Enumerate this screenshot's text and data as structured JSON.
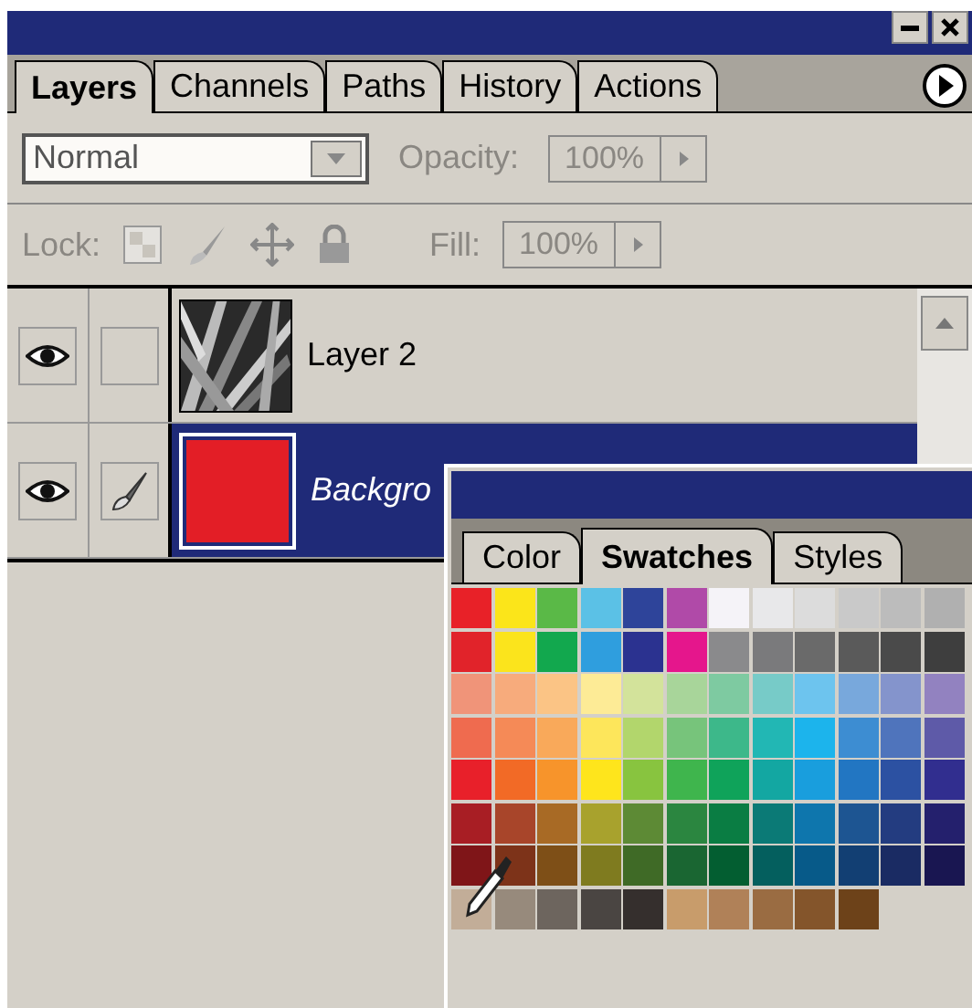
{
  "tabs": [
    {
      "label": "Layers",
      "selected": true
    },
    {
      "label": "Channels",
      "selected": false
    },
    {
      "label": "Paths",
      "selected": false
    },
    {
      "label": "History",
      "selected": false
    },
    {
      "label": "Actions",
      "selected": false
    }
  ],
  "blend_mode": {
    "value": "Normal"
  },
  "opacity": {
    "label": "Opacity:",
    "value": "100%",
    "disabled": true
  },
  "lock": {
    "label": "Lock:",
    "disabled": true
  },
  "fill": {
    "label": "Fill:",
    "value": "100%",
    "disabled": true
  },
  "layers": [
    {
      "name": "Layer 2",
      "selected": false,
      "visible": true,
      "brush": false,
      "kind": "picture"
    },
    {
      "name": "Backgro",
      "selected": true,
      "visible": true,
      "brush": true,
      "kind": "color",
      "color": "#e31e26"
    }
  ],
  "swatches_panel": {
    "tabs": [
      {
        "label": "Color",
        "selected": false
      },
      {
        "label": "Swatches",
        "selected": true
      },
      {
        "label": "Styles",
        "selected": false
      }
    ],
    "rows": [
      {
        "swatches": [
          {
            "color": "#e82128"
          },
          {
            "color": "#fbe51a"
          },
          {
            "color": "#5ab947"
          },
          {
            "color": "#5bc1e6"
          },
          {
            "color": "#2e449a"
          },
          {
            "color": "#b04aa8"
          },
          {
            "color": "#f5f3f8"
          },
          {
            "color": "#e8e8ea"
          },
          {
            "color": "#dcdcdc"
          },
          {
            "color": "#c9c9c9"
          },
          {
            "color": "#bcbcbc"
          },
          {
            "color": "#b0b0b0"
          }
        ]
      },
      {
        "swatches": [
          {
            "color": "#e1232a"
          },
          {
            "color": "#fbe41c"
          },
          {
            "color": "#12a84e"
          },
          {
            "color": "#2f9ede"
          },
          {
            "color": "#2b3290"
          },
          {
            "color": "#e5168c"
          },
          {
            "color": "#8a8a8c"
          },
          {
            "color": "#7a7a7c"
          },
          {
            "color": "#6a6a6a"
          },
          {
            "color": "#5a5a5a"
          },
          {
            "color": "#4a4a4a"
          },
          {
            "color": "#3e3e3e"
          }
        ]
      },
      {
        "swatches": [
          {
            "color": "#f09479"
          },
          {
            "color": "#f7ab7c"
          },
          {
            "color": "#fbc485"
          },
          {
            "color": "#fdeb96"
          },
          {
            "color": "#d3e39b"
          },
          {
            "color": "#a8d59a"
          },
          {
            "color": "#7ecaa1"
          },
          {
            "color": "#77cbc8"
          },
          {
            "color": "#6dc4ee"
          },
          {
            "color": "#78a8dc"
          },
          {
            "color": "#8494cc"
          },
          {
            "color": "#9282c0"
          }
        ]
      },
      {
        "swatches": [
          {
            "color": "#ef6b4f"
          },
          {
            "color": "#f58a57"
          },
          {
            "color": "#f9a95a"
          },
          {
            "color": "#fde65b"
          },
          {
            "color": "#b2d66c"
          },
          {
            "color": "#77c47b"
          },
          {
            "color": "#3db88a"
          },
          {
            "color": "#22b7b4"
          },
          {
            "color": "#1cb4ec"
          },
          {
            "color": "#3d8dd2"
          },
          {
            "color": "#4f74bc"
          },
          {
            "color": "#5e5aa8"
          }
        ]
      },
      {
        "swatches": [
          {
            "color": "#e8202a"
          },
          {
            "color": "#f26a26"
          },
          {
            "color": "#f7942b"
          },
          {
            "color": "#fee51c"
          },
          {
            "color": "#88c43f"
          },
          {
            "color": "#3fb54d"
          },
          {
            "color": "#0fa35a"
          },
          {
            "color": "#13a7a2"
          },
          {
            "color": "#199edd"
          },
          {
            "color": "#2276c2"
          },
          {
            "color": "#2c51a2"
          },
          {
            "color": "#312e8f"
          }
        ]
      },
      {
        "swatches": [
          {
            "color": "#a81e24"
          },
          {
            "color": "#a8452a"
          },
          {
            "color": "#a86a25"
          },
          {
            "color": "#a8a22d"
          },
          {
            "color": "#5d8a35"
          },
          {
            "color": "#2b8640"
          },
          {
            "color": "#0a7d43"
          },
          {
            "color": "#0b7a76"
          },
          {
            "color": "#0e76ad"
          },
          {
            "color": "#1d5592"
          },
          {
            "color": "#233c80"
          },
          {
            "color": "#24206d"
          }
        ]
      },
      {
        "swatches": [
          {
            "color": "#7f1518"
          },
          {
            "color": "#7d3319"
          },
          {
            "color": "#7e4f17"
          },
          {
            "color": "#7f7b1f"
          },
          {
            "color": "#3f6a26"
          },
          {
            "color": "#1a6632"
          },
          {
            "color": "#035e31"
          },
          {
            "color": "#045f5e"
          },
          {
            "color": "#075a89"
          },
          {
            "color": "#123f73"
          },
          {
            "color": "#1a2b63"
          },
          {
            "color": "#191651"
          }
        ]
      },
      {
        "swatches": [
          {
            "color": "#c2ad98"
          },
          {
            "color": "#978a7c"
          },
          {
            "color": "#6d655e"
          },
          {
            "color": "#4a4542"
          },
          {
            "color": "#352f2d"
          },
          {
            "color": "#c89c6b"
          },
          {
            "color": "#b08158"
          },
          {
            "color": "#9a6c42"
          },
          {
            "color": "#84552b"
          },
          {
            "color": "#6d4219"
          }
        ]
      }
    ]
  }
}
